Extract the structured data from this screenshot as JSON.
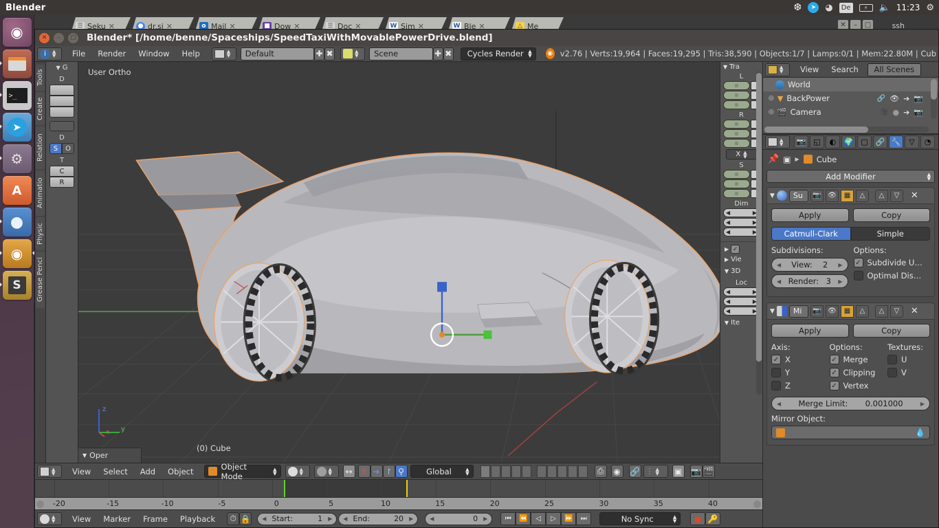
{
  "desktop": {
    "panel_title": "Blender",
    "clock": "11:23",
    "tray": [
      {
        "name": "dropbox-icon",
        "glyph": "❆"
      },
      {
        "name": "telegram-icon",
        "glyph": "➤"
      },
      {
        "name": "wifi-icon",
        "glyph": "◠"
      },
      {
        "name": "keyboard-layout-indicator",
        "glyph": "De"
      },
      {
        "name": "battery-icon",
        "glyph": "▭"
      },
      {
        "name": "volume-icon",
        "glyph": "🔊"
      }
    ],
    "session_icon": "power-gear-icon"
  },
  "launcher": {
    "items": [
      {
        "name": "ubuntu-dash-icon",
        "glyph": "◉",
        "color": "#8a4f6d",
        "running": false,
        "active": false
      },
      {
        "name": "files-icon",
        "glyph": "▤",
        "color": "#b45a4a",
        "running": true,
        "active": false
      },
      {
        "name": "terminal-icon",
        "glyph": "$_",
        "color": "#3b3b3b",
        "running": true,
        "active": false
      },
      {
        "name": "telegram-icon",
        "glyph": "➤",
        "color": "#2f90d8",
        "running": true,
        "active": false
      },
      {
        "name": "system-settings-icon",
        "glyph": "⚙",
        "color": "#7d6a80",
        "running": true,
        "active": false
      },
      {
        "name": "software-center-icon",
        "glyph": "A",
        "color": "#dd6a3c",
        "running": false,
        "active": false
      },
      {
        "name": "chromium-icon",
        "glyph": "●",
        "color": "#3d6fb5",
        "running": true,
        "active": false
      },
      {
        "name": "blender-icon",
        "glyph": "◉",
        "color": "#d09030",
        "running": true,
        "active": true
      },
      {
        "name": "sublime-text-icon",
        "glyph": "S",
        "color": "#c09a44",
        "running": true,
        "active": false
      }
    ]
  },
  "browser": {
    "tabs": [
      {
        "label": "Seku",
        "favicon": "page-icon",
        "color": "#c8c8c8"
      },
      {
        "label": "dr.si",
        "favicon": "chrome-icon",
        "color": "#4285f4"
      },
      {
        "label": "Mail",
        "favicon": "outlook-icon",
        "color": "#1b6ec2"
      },
      {
        "label": "Dow",
        "favicon": "twitch-icon",
        "color": "#6441a5"
      },
      {
        "label": "Doc",
        "favicon": "page-icon",
        "color": "#c8c8c8"
      },
      {
        "label": "Sim",
        "favicon": "word-icon",
        "color": "#ffffff"
      },
      {
        "label": "Ble",
        "favicon": "word-icon",
        "color": "#ffffff"
      },
      {
        "label": "Me",
        "favicon": "drive-icon",
        "color": "#f5d247"
      }
    ],
    "window_buttons": [
      "×",
      "–",
      "□"
    ],
    "terminal_label": "ssh"
  },
  "blender_window": {
    "title": "Blender* [/home/benne/Spaceships/SpeedTaxiWithMovablePowerDrive.blend]",
    "buttons": {
      "close": "×",
      "minimize": "–",
      "maximize": "□"
    }
  },
  "info_header": {
    "editor_icon": "info-editor-icon",
    "menus": [
      "File",
      "Render",
      "Window",
      "Help"
    ],
    "screen_layout": "Default",
    "scene_name": "Scene",
    "render_engine": "Cycles Render",
    "blender_logo": "blender-logo-icon",
    "stats": "v2.76 | Verts:19,964 | Faces:19,295 | Tris:38,590 | Objects:1/7 | Lamps:0/1 | Mem:22.80M | Cub",
    "add_button": "✚",
    "remove_button": "✖"
  },
  "viewport": {
    "view_label": "User Ortho",
    "object_label": "(0) Cube",
    "axis_gizmo": {
      "z": "z",
      "y": "y",
      "x": "x"
    },
    "operator_panel": "Oper",
    "toolshelf_tabs": [
      "Tools",
      "Create",
      "Relation",
      "Animatio",
      "Physic",
      "Grease Penci"
    ],
    "toolshelf": {
      "header": "G",
      "groups": [
        {
          "label": "D",
          "buttons": [
            "",
            "",
            "",
            ""
          ]
        },
        {
          "label": "D",
          "buttons": [
            "S",
            "O"
          ]
        },
        {
          "label": "T",
          "buttons": [
            "C",
            "R"
          ]
        }
      ]
    }
  },
  "npanel": {
    "transform_title": "Tra",
    "location_label": "L",
    "rotation_label": "R",
    "rotation_mode": "X",
    "scale_label": "S",
    "dimensions_label": "Dim",
    "view_label": "Vie",
    "three_d_cursor_title": "3D",
    "cursor_location_label": "Loc",
    "items_label": "Ite"
  },
  "vp_header": {
    "editor_icon": "3d-view-editor-icon",
    "menus": [
      "View",
      "Select",
      "Add",
      "Object"
    ],
    "mode": "Object Mode",
    "transform_orientation": "Global",
    "shading_icon": "viewport-shading-icon",
    "pivot_icon": "pivot-point-icon",
    "snap_icon": "snap-magnet-icon",
    "proportional_icon": "proportional-edit-icon",
    "render_icon": "render-button-icon"
  },
  "timeline": {
    "editor_icon": "timeline-editor-icon",
    "menus": [
      "View",
      "Marker",
      "Frame",
      "Playback"
    ],
    "use_preview_range_icon": "preview-range-icon",
    "lock_icon": "lock-icon",
    "start_label": "Start:",
    "start_value": "1",
    "end_label": "End:",
    "end_value": "20",
    "current_frame": "0",
    "transport": [
      "⏮",
      "⏪",
      "◁",
      "▷",
      "⏩",
      "⏭"
    ],
    "sync_mode": "No Sync",
    "record_icon": "record-icon",
    "keying_icon": "keying-set-icon",
    "ruler_ticks": [
      "-20",
      "-15",
      "-10",
      "-5",
      "0",
      "5",
      "10",
      "15",
      "20",
      "25",
      "30",
      "35",
      "40"
    ]
  },
  "outliner": {
    "editor_icon": "outliner-editor-icon",
    "menus": [
      "View",
      "Search"
    ],
    "display_mode": "All Scenes",
    "rows": [
      {
        "name": "World",
        "icon": "world-icon",
        "selected": true,
        "expandable": false,
        "extra": []
      },
      {
        "name": "BackPower",
        "icon": "mesh-triangle-icon",
        "selected": false,
        "expandable": true,
        "extra": [
          "link-icon",
          "eye-icon",
          "cursor-icon",
          "camera-icon"
        ]
      },
      {
        "name": "Camera",
        "icon": "camera-object-icon",
        "selected": false,
        "expandable": true,
        "extra": [
          "camera-data-icon",
          "eye-icon",
          "cursor-icon",
          "camera-icon"
        ]
      }
    ]
  },
  "properties": {
    "tabs": [
      {
        "name": "render-tab",
        "glyph": "📷",
        "active": false
      },
      {
        "name": "render-layers-tab",
        "glyph": "◱",
        "active": false
      },
      {
        "name": "scene-tab",
        "glyph": "◐",
        "active": false
      },
      {
        "name": "world-tab",
        "glyph": "🌍",
        "active": false
      },
      {
        "name": "object-tab",
        "glyph": "▢",
        "active": false
      },
      {
        "name": "constraints-tab",
        "glyph": "🔗",
        "active": false
      },
      {
        "name": "modifiers-tab",
        "glyph": "🔧",
        "active": true
      },
      {
        "name": "data-tab",
        "glyph": "▽",
        "active": false
      },
      {
        "name": "material-tab",
        "glyph": "◔",
        "active": false
      }
    ],
    "breadcrumb": {
      "pin_icon": "pin-icon",
      "object_icon": "object-icon",
      "separator": "▸",
      "object_name": "Cube",
      "cube_icon": "mesh-cube-icon"
    },
    "add_modifier": "Add Modifier",
    "modifiers": [
      {
        "name": "Su",
        "type": "subsurf",
        "icon": "subsurf-icon",
        "header_toggles": [
          "render-toggle-icon",
          "realtime-toggle-icon",
          "edit-mode-toggle-icon",
          "cage-toggle-icon"
        ],
        "move_up": "△",
        "move_down": "▽",
        "delete": "✕",
        "apply_label": "Apply",
        "copy_label": "Copy",
        "algorithms": [
          {
            "label": "Catmull-Clark",
            "active": true
          },
          {
            "label": "Simple",
            "active": false
          }
        ],
        "subdivisions_label": "Subdivisions:",
        "options_label": "Options:",
        "view_label": "View:",
        "view_value": "2",
        "render_label": "Render:",
        "render_value": "3",
        "checkboxes": [
          {
            "label": "Subdivide U…",
            "checked": true
          },
          {
            "label": "Optimal Dis…",
            "checked": false
          }
        ]
      },
      {
        "name": "Mi",
        "type": "mirror",
        "icon": "mirror-icon",
        "header_toggles": [
          "render-toggle-icon",
          "realtime-toggle-icon",
          "edit-mode-toggle-icon",
          "cage-toggle-icon"
        ],
        "move_up": "△",
        "move_down": "▽",
        "delete": "✕",
        "apply_label": "Apply",
        "copy_label": "Copy",
        "axis_label": "Axis:",
        "options_label": "Options:",
        "textures_label": "Textures:",
        "axis": [
          {
            "label": "X",
            "checked": true
          },
          {
            "label": "Y",
            "checked": false
          },
          {
            "label": "Z",
            "checked": false
          }
        ],
        "options": [
          {
            "label": "Merge",
            "checked": true
          },
          {
            "label": "Clipping",
            "checked": true
          },
          {
            "label": "Vertex",
            "checked": true
          }
        ],
        "textures": [
          {
            "label": "U",
            "checked": false
          },
          {
            "label": "V",
            "checked": false
          }
        ],
        "merge_limit_label": "Merge Limit:",
        "merge_limit_value": "0.001000",
        "mirror_object_label": "Mirror Object:",
        "mirror_object_value": "",
        "eyedropper_icon": "eyedropper-icon"
      }
    ]
  },
  "colors": {
    "accent_blue": "#4b78c8",
    "blender_orange": "#e87d0d",
    "axis_green": "#57a83e",
    "axis_red": "#a83e3e",
    "selection_orange": "#e9a36b",
    "panel_bg": "#4b4b4b",
    "viewport_bg": "#3c3c3c"
  }
}
